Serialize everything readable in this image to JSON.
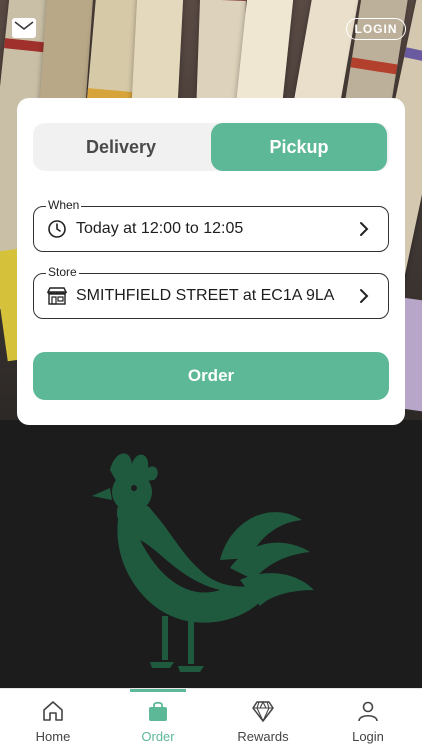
{
  "header": {
    "mail_icon": "mail-icon",
    "login_label": "LOGIN"
  },
  "card": {
    "toggle": {
      "delivery_label": "Delivery",
      "pickup_label": "Pickup",
      "selected": "Pickup"
    },
    "when": {
      "legend": "When",
      "value": "Today at 12:00 to 12:05",
      "icon": "clock-icon"
    },
    "store": {
      "legend": "Store",
      "value": "SMITHFIELD STREET at EC1A 9LA",
      "icon": "storefront-icon"
    },
    "order_label": "Order"
  },
  "bottom_nav": {
    "items": [
      {
        "label": "Home",
        "icon": "home-icon"
      },
      {
        "label": "Order",
        "icon": "bag-icon",
        "active": true
      },
      {
        "label": "Rewards",
        "icon": "diamond-icon"
      },
      {
        "label": "Login",
        "icon": "user-icon"
      }
    ]
  },
  "colors": {
    "accent": "#5cb896",
    "dark_bg": "#1c1c1c",
    "rooster": "#1f5a3f"
  }
}
